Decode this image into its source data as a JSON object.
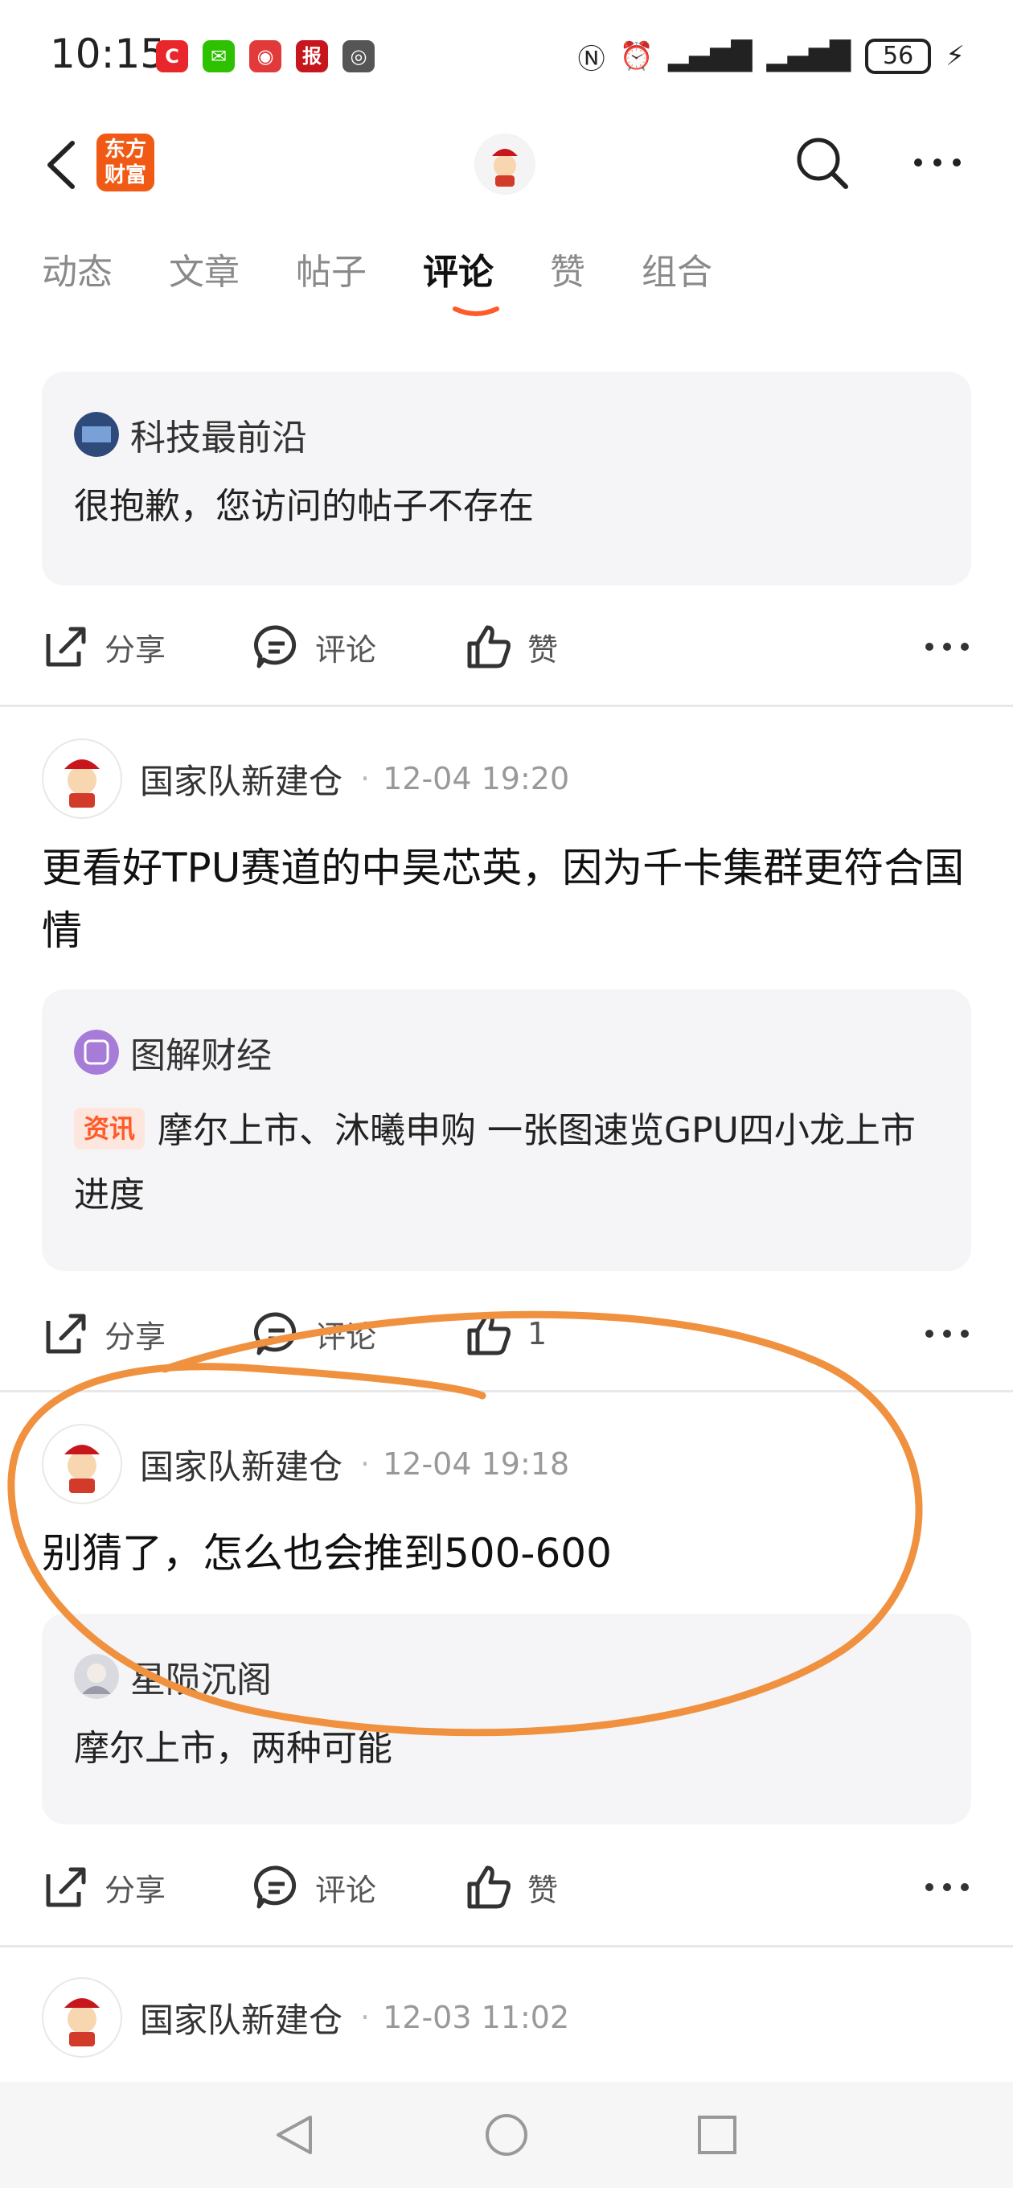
{
  "status_bar": {
    "time": "10:15",
    "battery": "56"
  },
  "header": {
    "brand_logo": "东方财富",
    "icons": [
      "back-icon",
      "search-icon",
      "more-icon"
    ]
  },
  "tabs": [
    "动态",
    "文章",
    "帖子",
    "评论",
    "赞",
    "组合"
  ],
  "active_tab": "评论",
  "feed": {
    "top_partial": {
      "quote_author": "科技最前沿",
      "quote_text": "很抱歉，您访问的帖子不存在",
      "actions": {
        "share": "分享",
        "comment": "评论",
        "like": "赞"
      }
    },
    "posts": [
      {
        "user": "国家队新建仓",
        "time": "12-04 19:20",
        "text": "更看好TPU赛道的中昊芯英，因为千卡集群更符合国情",
        "quote_author": "图解财经",
        "quote_tag": "资讯",
        "quote_text": "摩尔上市、沐曦申购 一张图速览GPU四小龙上市进度",
        "actions": {
          "share": "分享",
          "comment": "评论",
          "like": "1"
        }
      },
      {
        "user": "国家队新建仓",
        "time": "12-04 19:18",
        "text": "别猜了，怎么也会推到500-600",
        "quote_author": "星陨沉阁",
        "quote_text": "摩尔上市，两种可能",
        "actions": {
          "share": "分享",
          "comment": "评论",
          "like": "赞"
        }
      },
      {
        "user": "国家队新建仓",
        "time": "12-03 11:02"
      }
    ]
  },
  "colors": {
    "accent": "#ff5a28",
    "annotation": "#f0913f",
    "brand": "#f05a14"
  }
}
